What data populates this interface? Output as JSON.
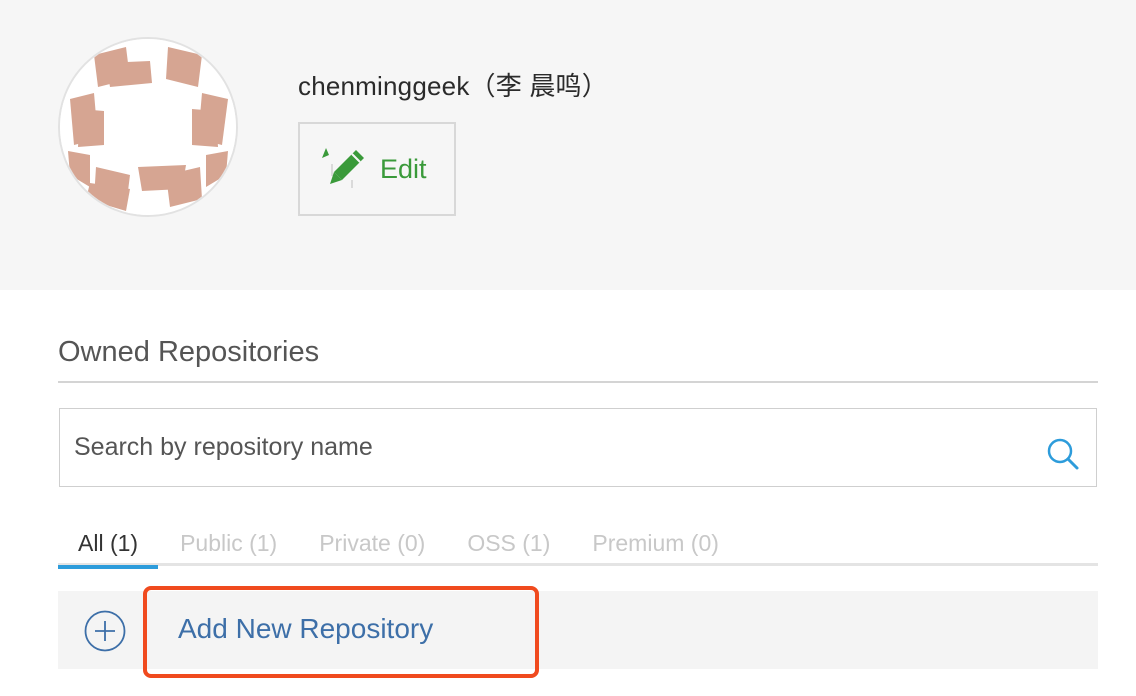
{
  "profile": {
    "username": "chenminggeek（李 晨鸣）",
    "edit_label": "Edit",
    "avatar_color": "#d6a592"
  },
  "repositories": {
    "section_title": "Owned Repositories",
    "search": {
      "placeholder": "Search by repository name",
      "value": ""
    },
    "tabs": [
      {
        "label": "All (1)",
        "active": true
      },
      {
        "label": "Public (1)",
        "active": false
      },
      {
        "label": "Private (0)",
        "active": false
      },
      {
        "label": "OSS (1)",
        "active": false
      },
      {
        "label": "Premium (0)",
        "active": false
      }
    ],
    "add_label": "Add New Repository"
  },
  "colors": {
    "accent": "#2d9cdb",
    "edit_green": "#3a9a3a",
    "link_blue": "#3d6fa8",
    "highlight": "#f04a1e"
  },
  "icons": [
    "pencil-icon",
    "search-icon",
    "plus-circle-icon"
  ]
}
